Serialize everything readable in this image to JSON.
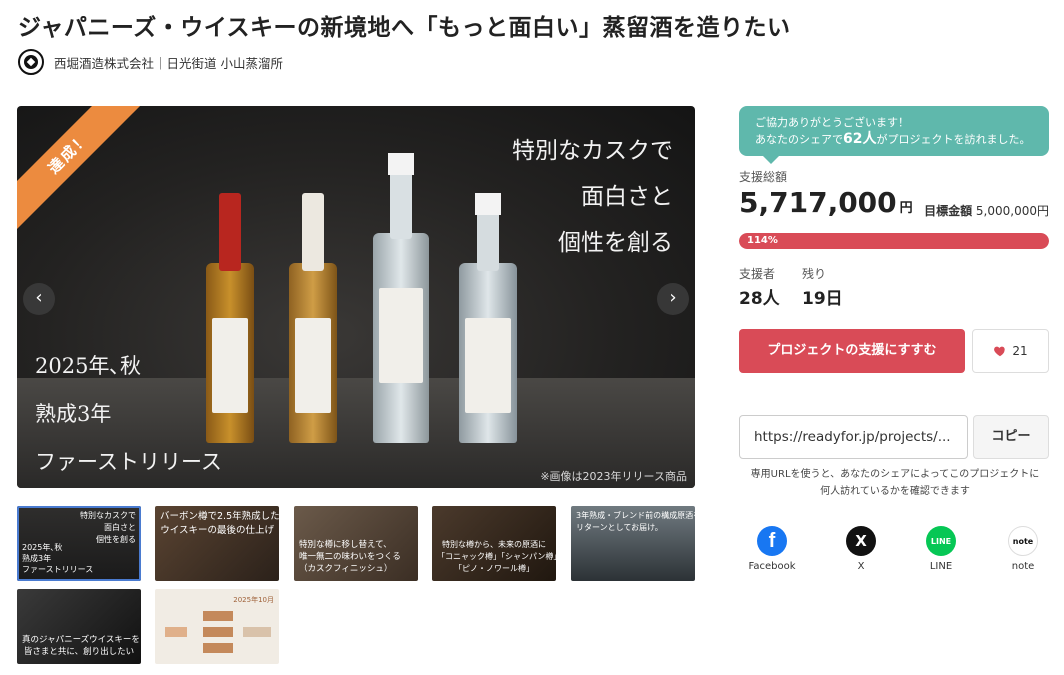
{
  "project": {
    "title": "ジャパニーズ・ウイスキーの新境地へ「もっと面白い」蒸留酒を造りたい",
    "owner": "西堀酒造株式会社｜日光街道 小山蒸溜所"
  },
  "hero": {
    "ribbon": "達成！",
    "copy_right": "特別なカスクで\n面白さと\n個性を創る",
    "copy_left": "2025年､秋\n熟成3年\nファーストリリース",
    "note": "※画像は2023年リリース商品",
    "prev": "‹",
    "next": "›"
  },
  "thumbnails": [
    {
      "top": "特別なカスクで\n面白さと\n個性を創る",
      "bottom": "2025年､秋\n熟成3年\nファーストリリース"
    },
    {
      "top": "バーボン樽で2.5年熟成した\nウイスキーの最後の仕上げ",
      "bottom": ""
    },
    {
      "top": "",
      "bottom": "特別な樽に移し替えて、\n唯一無二の味わいをつくる\n（カスクフィニッシュ）"
    },
    {
      "top": "",
      "bottom": "特別な樽から、未来の原酒に\n「コニャック樽」「シャンパン樽」\n「ピノ・ノワール樽」"
    },
    {
      "top": "3年熟成・ブレンド前の構成原酒を\nリターンとしてお届け。",
      "bottom": ""
    },
    {
      "top": "",
      "bottom": "真のジャパニーズウイスキーを\n皆さまと共に、創り出したい"
    },
    {
      "top": "2025年10月",
      "bottom": ""
    }
  ],
  "share_banner": {
    "line1": "ご協力ありがとうございます！",
    "line2_pre": "あなたのシェアで",
    "line2_count": "62人",
    "line2_post": "がプロジェクトを訪れました。"
  },
  "funding": {
    "total_label": "支援総額",
    "total_amount": "5,717,000",
    "unit": "円",
    "goal_label": "目標金額",
    "goal_amount": "5,000,000円",
    "progress_label": "114%",
    "progress_value": 1.14,
    "supporters_label": "支援者",
    "supporters_value": "28人",
    "remaining_label": "残り",
    "remaining_value": "19日"
  },
  "actions": {
    "support_button": "プロジェクトの支援にすすむ",
    "favorite_count": "21",
    "share_url": "https://readyfor.jp/projects/...",
    "copy_button": "コピー",
    "url_note": "専用URLを使うと、あなたのシェアによってこのプロジェクトに何人訪れているかを確認できます"
  },
  "social": [
    {
      "label": "Facebook",
      "glyph": "f"
    },
    {
      "label": "X",
      "glyph": "X"
    },
    {
      "label": "LINE",
      "glyph": "LINE"
    },
    {
      "label": "note",
      "glyph": "note"
    }
  ],
  "colors": {
    "accent_red": "#d94b57",
    "ribbon_orange": "#ec8b3f",
    "banner_teal": "#5fb8ac"
  }
}
